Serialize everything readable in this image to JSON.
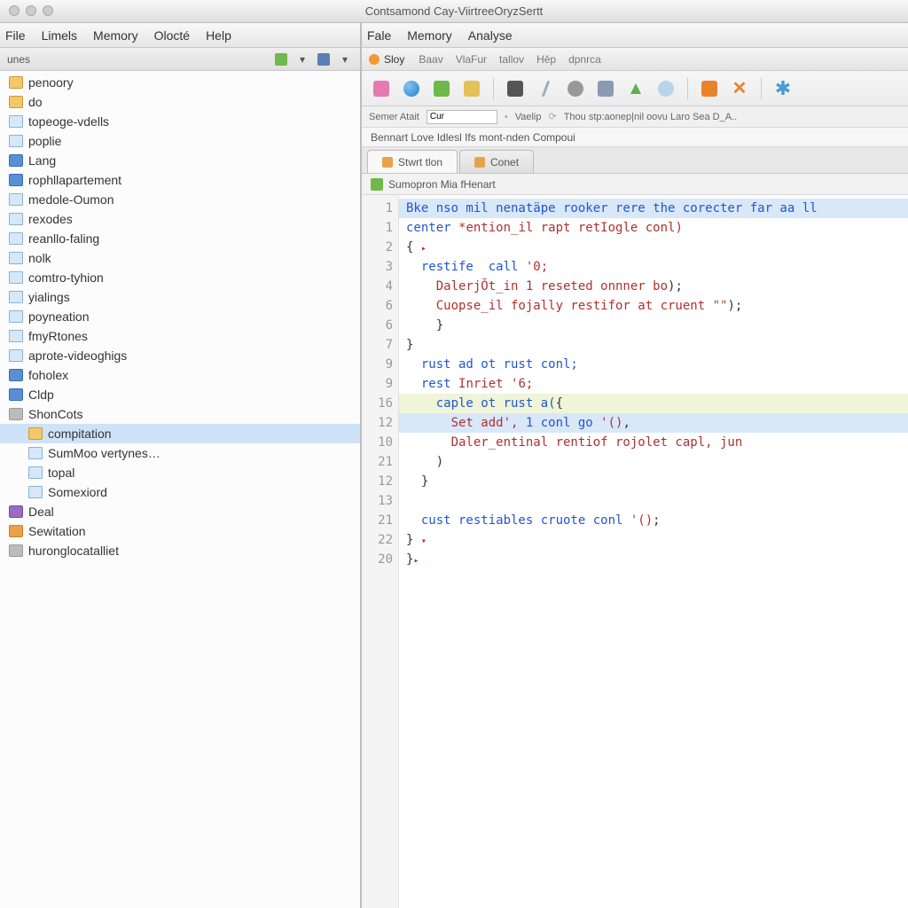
{
  "window": {
    "title": "Contsamond Cay-ViirtreeOryzSertt"
  },
  "left": {
    "menu": [
      "File",
      "Limels",
      "Memory",
      "Olocté",
      "Help"
    ],
    "panel_label": "unes",
    "tree": [
      {
        "label": "penoory",
        "icon": "folder",
        "indent": 0
      },
      {
        "label": "do",
        "icon": "folder",
        "indent": 0
      },
      {
        "label": "topeoge-vdells",
        "icon": "doc",
        "indent": 0
      },
      {
        "label": "poplie",
        "icon": "doc",
        "indent": 0
      },
      {
        "label": "Lang",
        "icon": "folder-blue",
        "indent": 0
      },
      {
        "label": "rophllapartement",
        "icon": "folder-blue",
        "indent": 0
      },
      {
        "label": "medole-Oumon",
        "icon": "doc",
        "indent": 0
      },
      {
        "label": "rexodes",
        "icon": "doc",
        "indent": 0
      },
      {
        "label": "reanllo-faling",
        "icon": "doc",
        "indent": 0
      },
      {
        "label": "nolk",
        "icon": "doc",
        "indent": 0
      },
      {
        "label": "comtro-tyhion",
        "icon": "doc",
        "indent": 0
      },
      {
        "label": "yialings",
        "icon": "doc",
        "indent": 0
      },
      {
        "label": "poyneation",
        "icon": "doc",
        "indent": 0
      },
      {
        "label": "fmyRtones",
        "icon": "doc",
        "indent": 0
      },
      {
        "label": "aprote-videoghigs",
        "icon": "doc",
        "indent": 0
      },
      {
        "label": "foholex",
        "icon": "folder-blue",
        "indent": 0
      },
      {
        "label": "Cldp",
        "icon": "folder-blue",
        "indent": 0
      },
      {
        "label": "ShonCots",
        "icon": "folder-gray",
        "indent": 0
      },
      {
        "label": "compitation",
        "icon": "folder",
        "indent": 1,
        "selected": true
      },
      {
        "label": "SumMoo vertynes…",
        "icon": "doc",
        "indent": 1
      },
      {
        "label": "topal",
        "icon": "doc",
        "indent": 1
      },
      {
        "label": "Somexiord",
        "icon": "doc",
        "indent": 1
      },
      {
        "label": "Deal",
        "icon": "square-purple",
        "indent": 0
      },
      {
        "label": "Sewitation",
        "icon": "square-orange",
        "indent": 0
      },
      {
        "label": "huronglocatalliet",
        "icon": "folder-gray",
        "indent": 0
      }
    ]
  },
  "right": {
    "menu": [
      "Fale",
      "Memory",
      "Analyse"
    ],
    "ribbon": {
      "lead": "Sloy",
      "items": [
        "Baav",
        "VlaFur",
        "tallov",
        "Hěp",
        "dpnrca"
      ]
    },
    "findbar": {
      "label1": "Semer Atait",
      "value1": "Cur",
      "label2": "Vaelip",
      "trail": "Thou stp:aonep|nil oovu Laro Sea D_A.."
    },
    "crumb": "Bennart Love Idlesl Ifs mont-nden Compoui",
    "tabs": [
      {
        "label": "Stwrt tlon",
        "active": true
      },
      {
        "label": "Conet",
        "active": false
      }
    ],
    "pathbar": "Sumopron Mia fHenart",
    "gutter": [
      "1",
      "1",
      "2",
      "3",
      "4",
      "6",
      "6",
      "7",
      "9",
      "9",
      "16",
      "12",
      "10",
      "21",
      "12",
      "13",
      "21",
      "22",
      "20"
    ],
    "code": [
      {
        "cls": "hl1",
        "seg": [
          [
            "k-blue",
            "Bke nso mil nenatäpe rooker rere the corecter far aa ll"
          ]
        ]
      },
      {
        "cls": "",
        "seg": [
          [
            "k-blue",
            "center "
          ],
          [
            "k-red",
            "*ention_il rapt retIogle conl)"
          ]
        ]
      },
      {
        "cls": "",
        "seg": [
          [
            "k-dark",
            "{ "
          ],
          [
            "arrow",
            "▸"
          ]
        ]
      },
      {
        "cls": "",
        "seg": [
          [
            "k-blue",
            "  restife  call "
          ],
          [
            "k-red",
            "'0;"
          ]
        ]
      },
      {
        "cls": "",
        "seg": [
          [
            "k-red",
            "    DalerjŎt_in 1 reseted onnner bo"
          ],
          [
            "k-dark",
            ");"
          ]
        ]
      },
      {
        "cls": "",
        "seg": [
          [
            "k-red",
            "    Cuopse_il fojally restifor at cruent "
          ],
          [
            "k-brown",
            "\"\""
          ],
          [
            "k-dark",
            ");"
          ]
        ]
      },
      {
        "cls": "",
        "seg": [
          [
            "k-dark",
            "    }"
          ]
        ]
      },
      {
        "cls": "",
        "seg": [
          [
            "k-dark",
            "}"
          ]
        ]
      },
      {
        "cls": "",
        "seg": [
          [
            "k-blue",
            "  rust ad ot rust conl;"
          ]
        ]
      },
      {
        "cls": "",
        "seg": [
          [
            "k-blue",
            "  rest "
          ],
          [
            "k-red",
            "Inriet '6;"
          ]
        ]
      },
      {
        "cls": "hl3",
        "seg": [
          [
            "k-blue",
            "    caple ot rust a("
          ],
          [
            "k-dark",
            "{"
          ]
        ]
      },
      {
        "cls": "hl1",
        "seg": [
          [
            "k-red",
            "      Set add', "
          ],
          [
            "k-blue",
            "1 conl go "
          ],
          [
            "k-red",
            "'()"
          ],
          [
            "k-dark",
            ","
          ]
        ]
      },
      {
        "cls": "",
        "seg": [
          [
            "k-red",
            "      Daler_entinal rentiof rojolet capl, jun"
          ]
        ]
      },
      {
        "cls": "",
        "seg": [
          [
            "k-dark",
            "    )"
          ]
        ]
      },
      {
        "cls": "",
        "seg": [
          [
            "k-dark",
            "  }"
          ]
        ]
      },
      {
        "cls": "",
        "seg": [
          [
            "k-dark",
            ""
          ]
        ]
      },
      {
        "cls": "",
        "seg": [
          [
            "k-blue",
            "  cust restiables cruote conl "
          ],
          [
            "k-red",
            "'()"
          ],
          [
            "k-dark",
            ";"
          ]
        ]
      },
      {
        "cls": "",
        "seg": [
          [
            "k-dark",
            "} "
          ],
          [
            "arrow",
            "▾"
          ]
        ]
      },
      {
        "cls": "",
        "seg": [
          [
            "k-dark",
            "}"
          ],
          [
            "arrow",
            "▸"
          ]
        ]
      }
    ]
  }
}
